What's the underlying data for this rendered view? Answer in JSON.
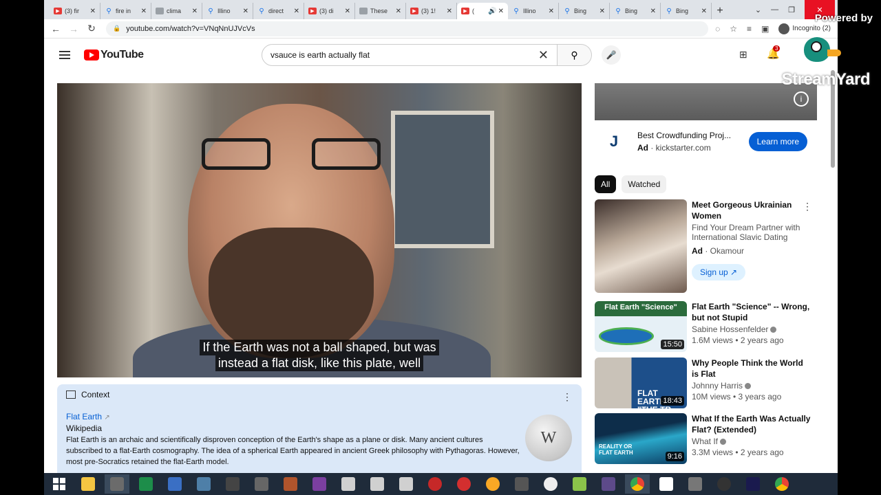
{
  "browser": {
    "tabs": [
      {
        "title": "(3) fir",
        "icon": "youtube-icon"
      },
      {
        "title": "fire in",
        "icon": "bing-search-icon"
      },
      {
        "title": "clima",
        "icon": "page-icon"
      },
      {
        "title": "Illino",
        "icon": "bing-search-icon"
      },
      {
        "title": "direct",
        "icon": "bing-search-icon"
      },
      {
        "title": "(3) di",
        "icon": "youtube-icon"
      },
      {
        "title": "These",
        "icon": "page-icon"
      },
      {
        "title": "(3) 1!",
        "icon": "youtube-icon"
      },
      {
        "title": "(",
        "icon": "youtube-icon",
        "active": true
      },
      {
        "title": "Illino",
        "icon": "bing-search-icon"
      },
      {
        "title": "Bing",
        "icon": "bing-search-icon"
      },
      {
        "title": "Bing",
        "icon": "bing-search-icon"
      },
      {
        "title": "Bing",
        "icon": "bing-search-icon"
      }
    ],
    "url": "youtube.com/watch?v=VNqNnUJVcVs",
    "incognito_label": "Incognito (2)"
  },
  "youtube": {
    "logo_text": "YouTube",
    "search_query": "vsauce is earth actually flat",
    "notification_count": "3"
  },
  "video": {
    "caption_line1": "If the Earth was not a ball shaped, but was",
    "caption_line2": "instead a flat disk, like this plate, well"
  },
  "context_panel": {
    "header": "Context",
    "link_title": "Flat Earth",
    "source": "Wikipedia",
    "body": "Flat Earth is an archaic and scientifically disproven conception of the Earth's shape as a plane or disk. Many ancient cultures subscribed to a flat-Earth cosmography. The idea of a spherical Earth appeared in ancient Greek philosophy with Pythagoras. However, most pre-Socratics retained the flat-Earth model."
  },
  "ad": {
    "title": "Best Crowdfunding Proj...",
    "ad_label": "Ad",
    "domain": "kickstarter.com",
    "button": "Learn more"
  },
  "chips": [
    "All",
    "Watched"
  ],
  "recommendations": [
    {
      "title": "Meet Gorgeous Ukrainian Women",
      "desc": "Find Your Dream Partner with International Slavic Dating",
      "ad_label": "Ad",
      "advertiser": "Okamour",
      "button": "Sign up"
    },
    {
      "title": "Flat Earth \"Science\" -- Wrong, but not Stupid",
      "channel": "Sabine Hossenfelder",
      "stats": "1.6M views • 2 years ago",
      "duration": "15:50",
      "thumb_text": "Flat Earth \"Science\""
    },
    {
      "title": "Why People Think the World is Flat",
      "channel": "Johnny Harris",
      "stats": "10M views • 3 years ago",
      "duration": "18:43",
      "thumb_text": "FLAT EARTH \"THE TR"
    },
    {
      "title": "What If the Earth Was Actually Flat? (Extended)",
      "channel": "What If",
      "stats": "3.3M views • 2 years ago",
      "duration": "9:16",
      "thumb_text": "REALITY OR FLAT EARTH"
    }
  ],
  "overlay": {
    "powered_by": "Powered by",
    "brand": "StreamYard"
  },
  "colors": {
    "youtube_red": "#ff0000",
    "link_blue": "#065fd4",
    "context_bg": "#dbe8f8",
    "taskbar_bg": "#1f2b3a"
  },
  "taskbar_apps": [
    "start-icon",
    "file-explorer-icon",
    "app-icon",
    "excel-icon",
    "app-icon",
    "app-icon",
    "app-icon",
    "app-icon",
    "app-icon",
    "app-icon",
    "app-icon",
    "app-icon",
    "app-icon",
    "app-icon",
    "app-icon",
    "app-icon",
    "app-icon",
    "app-icon",
    "app-icon",
    "app-icon",
    "app-icon",
    "chrome-icon",
    "page-icon",
    "app-icon",
    "app-icon",
    "after-effects-icon",
    "chrome-icon"
  ]
}
